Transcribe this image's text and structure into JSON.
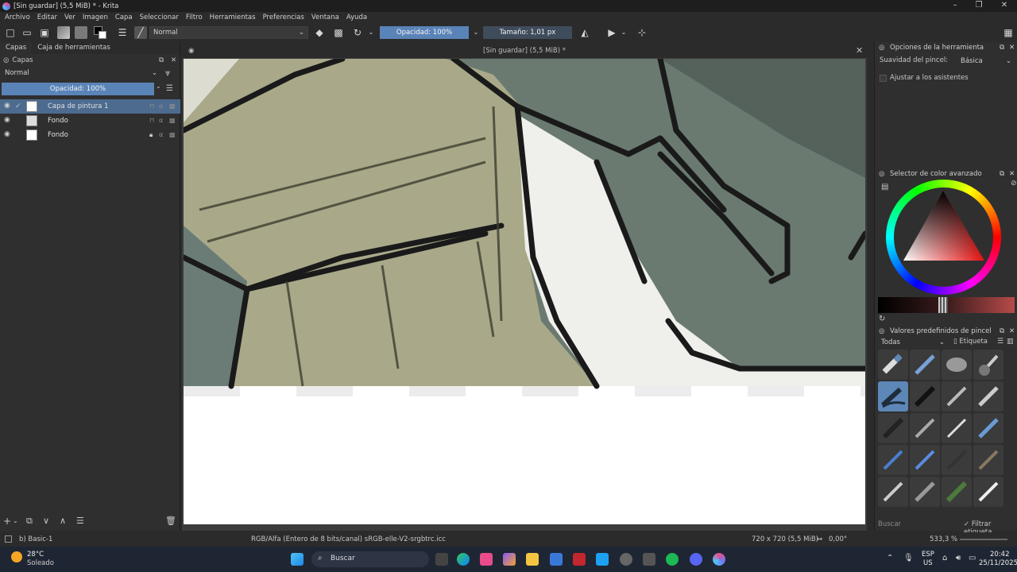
{
  "window": {
    "title": "[Sin guardar]  (5,5 MiB) * - Krita"
  },
  "menu": [
    "Archivo",
    "Editar",
    "Ver",
    "Imagen",
    "Capa",
    "Seleccionar",
    "Filtro",
    "Herramientas",
    "Preferencias",
    "Ventana",
    "Ayuda"
  ],
  "toolbar": {
    "blend_mode": "Normal",
    "opacity": "Opacidad: 100%",
    "size": "Tamaño: 1,01 px"
  },
  "left_dock": {
    "tabs": [
      "Capas",
      "Caja de herramientas"
    ],
    "panel_title": "Capas",
    "blend_mode": "Normal",
    "opacity": "Opacidad: 100%",
    "layers": [
      {
        "name": "Capa de pintura 1",
        "selected": true
      },
      {
        "name": "Fondo",
        "selected": false
      },
      {
        "name": "Fondo",
        "selected": false
      }
    ]
  },
  "document": {
    "title": "[Sin guardar]  (5,5 MiB) *"
  },
  "right_dock": {
    "tool_options": {
      "title": "Opciones de la herramienta",
      "smoothing_label": "Suavidad del pincel:",
      "smoothing_value": "Básica",
      "assistants_label": "Ajustar a los asistentes"
    },
    "color_selector": {
      "title": "Selector de color avanzado"
    },
    "brush_presets": {
      "title": "Valores predefinidos de pincel",
      "filter": "Todas",
      "tag_label": "Etiqueta",
      "search_placeholder": "Buscar",
      "filter_tag_label": "Filtrar etiqueta"
    }
  },
  "statusbar": {
    "brush": "b) Basic-1",
    "color_profile": "RGB/Alfa (Entero de 8 bits/canal)  sRGB-elle-V2-srgbtrc.icc",
    "image_size": "720 x 720 (5,5 MiB)",
    "rotation": "0,00°",
    "zoom": "533,3 %"
  },
  "taskbar": {
    "weather_temp": "28°C",
    "weather_desc": "Soleado",
    "search_label": "Buscar",
    "lang_top": "ESP",
    "lang_bottom": "US",
    "time": "20:42",
    "date": "25/11/2025"
  },
  "colors": {
    "accent": "#5a84b8",
    "selected_layer": "#4c6b8f",
    "canvas_olive": "#a9a98a",
    "canvas_teal": "#5f7268"
  }
}
